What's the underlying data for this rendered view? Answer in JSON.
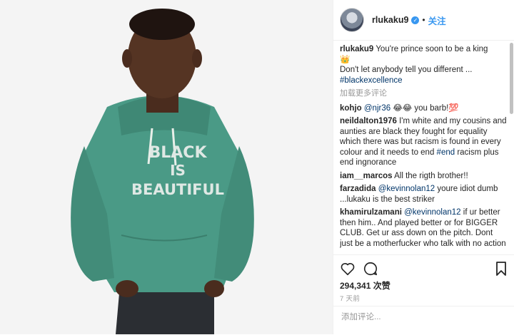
{
  "header": {
    "username": "rlukaku9",
    "follow_label": "关注",
    "separator": "•"
  },
  "photo": {
    "shirt_line1": "BLACK",
    "shirt_line2": "IS",
    "shirt_line3": "BEAUTIFUL"
  },
  "caption": {
    "username": "rlukaku9",
    "text1": "You're prince soon to be a king",
    "emoji": "👑",
    "text2": "Don't let anybody tell you different ...",
    "hashtag": "#blackexcellence"
  },
  "load_more": "加载更多评论",
  "comments": [
    {
      "user": "kohjo",
      "mention": "@njr36",
      "text": " 😂😂 you barb!💯"
    },
    {
      "user": "neildalton1976",
      "pre": " I'm white and my cousins and aunties are black they fought for equality which there was but racism is found in every colour and it needs to end ",
      "hashtag": "#end",
      "post": " racism plus end ingnorance"
    },
    {
      "user": "iam__marcos",
      "text": " All the rigth brother!!"
    },
    {
      "user": "farzadida",
      "mention": "@kevinnolan12",
      "text": " youre idiot dumb ...lukaku is the best striker"
    },
    {
      "user": "khamirulzamani",
      "mention": "@kevinnolan12",
      "text": " if ur better then him.. And played better or for BIGGER CLUB. Get ur ass down on the pitch. Dont just be a motherfucker who talk with no action"
    }
  ],
  "stats": {
    "likes": "294,341 次赞",
    "time": "7 天前"
  },
  "add_comment": {
    "placeholder": "添加评论..."
  },
  "colors": {
    "accent": "#3897f0",
    "hoodie": "#4a9a86",
    "link": "#003569"
  }
}
